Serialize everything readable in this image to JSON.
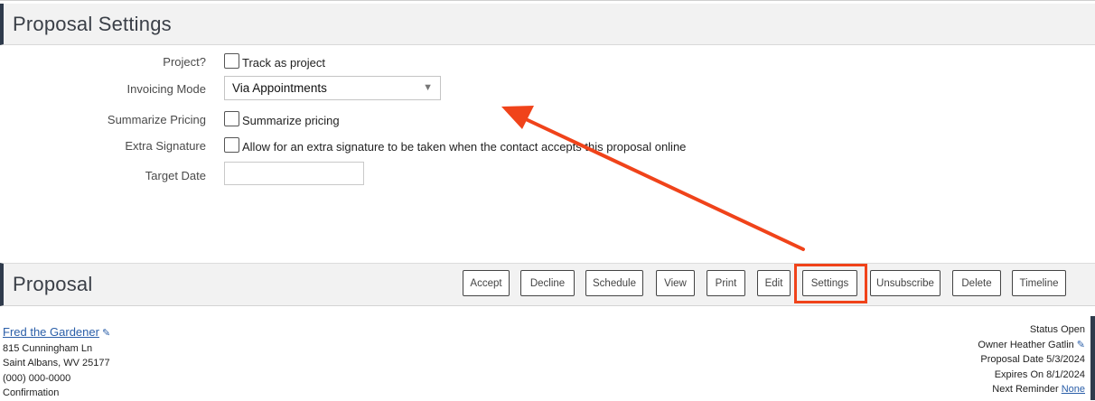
{
  "settings": {
    "title": "Proposal Settings",
    "rows": [
      {
        "label": "Project?",
        "text": "Track as project"
      },
      {
        "label": "Invoicing Mode",
        "value": "Via Appointments"
      },
      {
        "label": "Summarize Pricing",
        "text": "Summarize pricing"
      },
      {
        "label": "Extra Signature",
        "text": "Allow for an extra signature to be taken when the contact accepts this proposal online"
      },
      {
        "label": "Target Date",
        "value": ""
      }
    ]
  },
  "proposal": {
    "title": "Proposal",
    "buttons": [
      "Accept",
      "Decline",
      "Schedule",
      "View",
      "Print",
      "Edit",
      "Settings",
      "Unsubscribe",
      "Delete",
      "Timeline"
    ],
    "contact": {
      "name": "Fred the Gardener",
      "address1": "815 Cunningham Ln",
      "address2": "Saint Albans, WV 25177",
      "phone": "(000) 000-0000",
      "extra": "Confirmation"
    },
    "status": {
      "status": "Status Open",
      "owner": "Owner Heather Gatlin",
      "proposal_date": "Proposal Date 5/3/2024",
      "expires": "Expires On 8/1/2024",
      "reminder_label": "Next Reminder",
      "reminder_value": "None"
    }
  },
  "colors": {
    "accent": "#f0431a",
    "link": "#2a5ea8",
    "header_bar": "#2f3b4c"
  }
}
